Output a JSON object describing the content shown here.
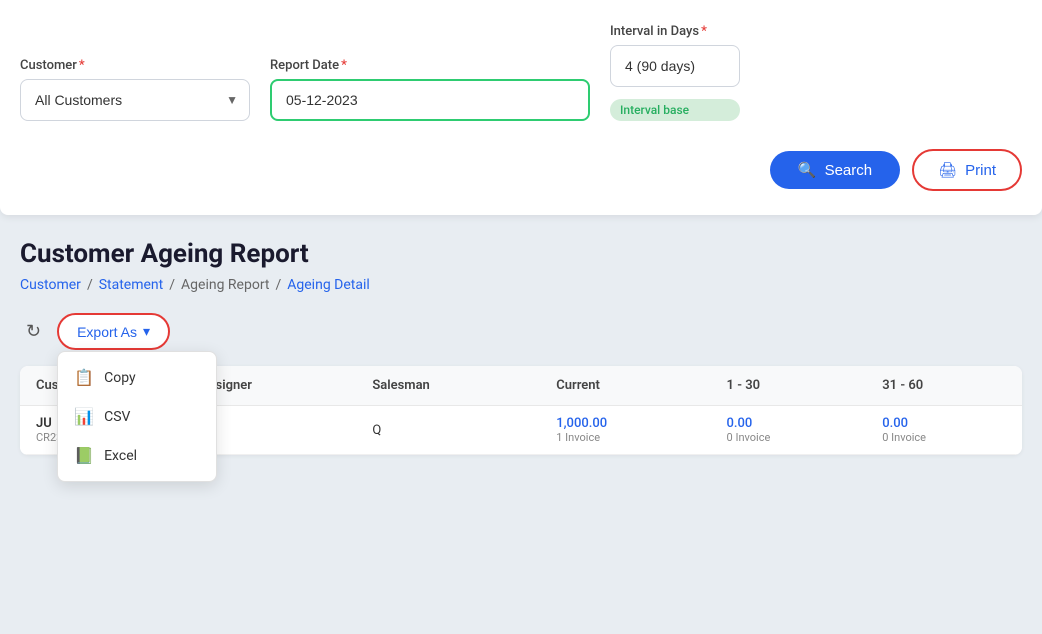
{
  "top_panel": {
    "customer_label": "Customer",
    "customer_required": "*",
    "customer_options": [
      "All Customers"
    ],
    "customer_selected": "All Customers",
    "report_date_label": "Report Date",
    "report_date_required": "*",
    "report_date_value": "05-12-2023",
    "interval_label": "Interval in Days",
    "interval_required": "*",
    "interval_value": "4 (90 days)",
    "interval_badge": "Interval base",
    "search_label": "Search",
    "print_label": "Print"
  },
  "page": {
    "title": "Customer Ageing Report",
    "breadcrumb": [
      {
        "text": "Customer",
        "link": true
      },
      {
        "text": "/",
        "link": false
      },
      {
        "text": "Statement",
        "link": true
      },
      {
        "text": "/",
        "link": false
      },
      {
        "text": "Ageing Report",
        "link": false
      },
      {
        "text": "/",
        "link": false
      },
      {
        "text": "Ageing Detail",
        "link": true
      }
    ]
  },
  "toolbar": {
    "export_label": "Export As",
    "export_arrow": "▾",
    "dropdown": [
      {
        "icon": "📋",
        "label": "Copy"
      },
      {
        "icon": "📊",
        "label": "CSV"
      },
      {
        "icon": "📗",
        "label": "Excel"
      }
    ]
  },
  "table": {
    "columns": [
      "Cus",
      "Assigner",
      "Salesman",
      "Current",
      "1 - 30",
      "31 - 60"
    ],
    "rows": [
      {
        "customer": "JU",
        "customer_code": "CR2302-1",
        "assigner": "",
        "salesman": "Q",
        "current": "1,000.00",
        "current_sub": "1 Invoice",
        "col1_30": "0.00",
        "col1_30_sub": "0 Invoice",
        "col31_60": "0.00",
        "col31_60_sub": "0 Invoice"
      }
    ]
  },
  "icons": {
    "search": "🔍",
    "print": "🖨",
    "refresh": "↻"
  }
}
